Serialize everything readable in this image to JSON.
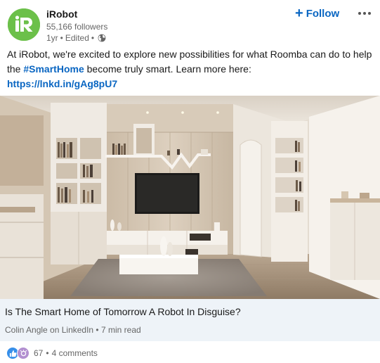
{
  "post": {
    "author": {
      "name": "iRobot",
      "followers": "55,166 followers",
      "age": "1yr",
      "edited": "Edited",
      "visibility_icon": "globe-icon",
      "logo_letter": "R",
      "logo_color": "#6cc04a"
    },
    "actions": {
      "follow_label": "Follow",
      "follow_icon": "plus-icon",
      "more_icon": "ellipsis-icon"
    },
    "commentary": {
      "text_before": "At iRobot, we're excited to explore new possibilities for what Roomba can do to help the ",
      "hashtag": "#SmartHome",
      "text_after": " become truly smart. Learn more here: ",
      "link": "https://lnkd.in/gAg8pU7"
    },
    "image": {
      "description_icon": "living-room-photo"
    },
    "article": {
      "title": "Is The Smart Home of Tomorrow A Robot In Disguise?",
      "source": "Colin Angle on LinkedIn",
      "read_time": "7 min read"
    },
    "social": {
      "reactions_count": "67",
      "comments": "4 comments",
      "reaction_icons": [
        "like-icon",
        "celebrate-icon"
      ]
    },
    "colors": {
      "brand_blue": "#0a66c2",
      "card_bg": "#eef3f8"
    }
  }
}
